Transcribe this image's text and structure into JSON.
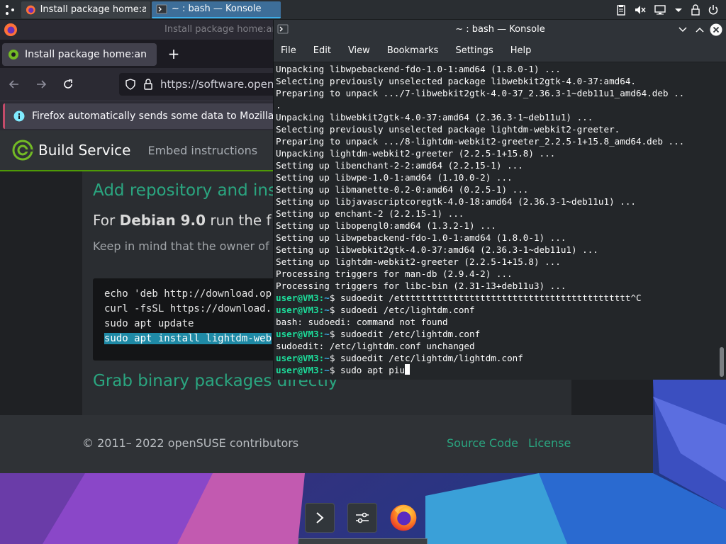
{
  "taskbar": {
    "tasks": [
      {
        "label": "Install package home:a..."
      },
      {
        "label": "~ : bash — Konsole"
      }
    ]
  },
  "firefox": {
    "window_title": "Install package home:an",
    "tab_title": "Install package home:an",
    "url": "https://software.opens",
    "notice": "Firefox automatically sends some data to Mozilla so"
  },
  "page": {
    "brand": "Build Service",
    "nav_embed": "Embed instructions",
    "heading_add": "Add repository and ins",
    "for_prefix": "For ",
    "for_distro": "Debian 9.0",
    "for_suffix": " run the f",
    "keep_in_mind": "Keep in mind that the owner of repositories that your system w",
    "code_lines": [
      "echo 'deb http://download.op",
      "curl -fsSL https://download.",
      "sudo apt update",
      "sudo apt install lightdm-web"
    ],
    "heading_grab": "Grab binary packages directly",
    "copyright": "© 2011– 2022 openSUSE contributors",
    "source_code": "Source Code",
    "license": "License"
  },
  "konsole": {
    "title": "~ : bash — Konsole",
    "menu": [
      "File",
      "Edit",
      "View",
      "Bookmarks",
      "Settings",
      "Help"
    ],
    "lines": [
      "Unpacking libwpebackend-fdo-1.0-1:amd64 (1.8.0-1) ...",
      "Selecting previously unselected package libwebkit2gtk-4.0-37:amd64.",
      "Preparing to unpack .../7-libwebkit2gtk-4.0-37_2.36.3-1~deb11u1_amd64.deb ..",
      ".",
      "Unpacking libwebkit2gtk-4.0-37:amd64 (2.36.3-1~deb11u1) ...",
      "Selecting previously unselected package lightdm-webkit2-greeter.",
      "Preparing to unpack .../8-lightdm-webkit2-greeter_2.2.5-1+15.8_amd64.deb ...",
      "Unpacking lightdm-webkit2-greeter (2.2.5-1+15.8) ...",
      "Setting up libenchant-2-2:amd64 (2.2.15-1) ...",
      "Setting up libwpe-1.0-1:amd64 (1.10.0-2) ...",
      "Setting up libmanette-0.2-0:amd64 (0.2.5-1) ...",
      "Setting up libjavascriptcoregtk-4.0-18:amd64 (2.36.3-1~deb11u1) ...",
      "Setting up enchant-2 (2.2.15-1) ...",
      "Setting up libopengl0:amd64 (1.3.2-1) ...",
      "Setting up libwpebackend-fdo-1.0-1:amd64 (1.8.0-1) ...",
      "Setting up libwebkit2gtk-4.0-37:amd64 (2.36.3-1~deb11u1) ...",
      "Setting up lightdm-webkit2-greeter (2.2.5-1+15.8) ...",
      "Processing triggers for man-db (2.9.4-2) ...",
      "Processing triggers for libc-bin (2.31-13+deb11u3) ..."
    ],
    "prompt_user": "user@VM3",
    "prompt_sep": ":",
    "prompt_path": "~",
    "prompt_dollar": "$ ",
    "commands": [
      {
        "cmd": "sudoedit /ettttttttttttttttttttttttttttttttttttttttttt^C",
        "output": ""
      },
      {
        "cmd": "sudoedi /etc/lightdm.conf",
        "output": "bash: sudoedi: command not found"
      },
      {
        "cmd": "sudoedit /etc/lightdm.conf",
        "output": "sudoedit: /etc/lightdm.conf unchanged"
      },
      {
        "cmd": "sudoedit /etc/lightdm/lightdm.conf",
        "output": ""
      },
      {
        "cmd": "sudo apt piu",
        "output": ""
      }
    ]
  },
  "colors": {
    "accent": "#3daee9",
    "obs_green": "#2aa680",
    "prompt_green": "#1cdc9a",
    "selection": "#1f8aa6"
  },
  "icons": {
    "launcher": "kde-launcher-icon",
    "firefox": "firefox-icon",
    "konsole": "konsole-icon",
    "tray": [
      "clipboard-icon",
      "volume-muted-icon",
      "network-icon",
      "chevron-down-icon",
      "lock-icon",
      "power-icon"
    ]
  }
}
